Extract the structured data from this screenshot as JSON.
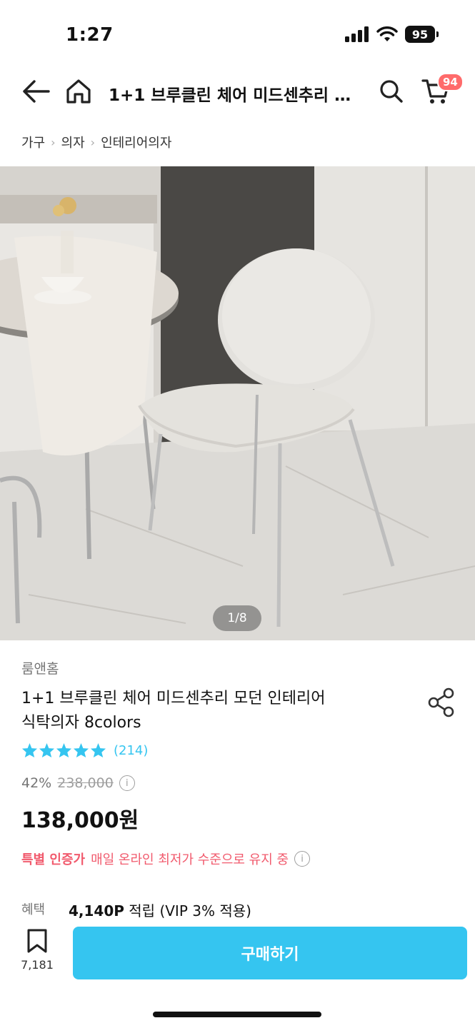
{
  "status": {
    "time": "1:27",
    "battery": "95"
  },
  "header": {
    "title": "1+1 브루클린 체어 미드센추리 모던 인테리어 식탁의자 8colors",
    "cart_count": "94"
  },
  "breadcrumb": [
    "가구",
    "의자",
    "인테리어의자"
  ],
  "gallery": {
    "indicator": "1/8"
  },
  "product": {
    "brand": "룸앤홈",
    "title_line1": "1+1 브루클린 체어 미드센추리 모던 인테리어",
    "title_line2": "식탁의자 8colors",
    "rating": 5,
    "review_count": "(214)",
    "discount": "42%",
    "original_price": "238,000",
    "price": "138,000원",
    "special_bold": "특별 인증가",
    "special_text": "매일 온라인 최저가 수준으로 유지 중",
    "benefit_label": "혜택",
    "benefit_points": "4,140P",
    "benefit_text": "적립 (VIP 3% 적용)"
  },
  "bottom_bar": {
    "bookmark_count": "7,181",
    "buy_label": "구매하기"
  },
  "colors": {
    "accent": "#35c5f0",
    "special": "#f15a6d",
    "badge": "#ff6b6b"
  }
}
